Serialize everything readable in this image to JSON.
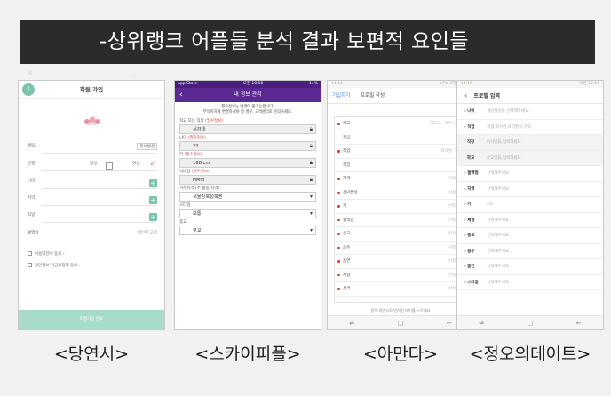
{
  "banner": {
    "title": "-상위랭크 어플들 분석 결과 보편적 요인들"
  },
  "captions": [
    "<당연시>",
    "<스카이피플>",
    "<아만다>",
    "<정오의데이트>"
  ],
  "phone1": {
    "title": "회원 가입",
    "rows": [
      {
        "label": "세팅1",
        "value": "정보변경"
      },
      {
        "label": "성별",
        "value": "남성",
        "extra": "여성"
      },
      {
        "label": "나이",
        "value": "+"
      },
      {
        "label": "지역",
        "value": "+"
      },
      {
        "label": "직업",
        "value": "+"
      },
      {
        "label": "혈액형",
        "value": "확인된 고정"
      }
    ],
    "checks": [
      "이용약관에 동의",
      "개인정보 취급방침에 동의"
    ],
    "footer": "회원가입 완료"
  },
  "phone2": {
    "status_left": "App Store",
    "status_time": "오전 10:10",
    "status_right": "14%",
    "title": "내 정보 관리",
    "note1": "필수정보는 변경이 불가능합니다.",
    "note2": "부득이하게 변경하셔야 할 경우, 고객센터로 문의하세요.",
    "fields": [
      {
        "label": "학교 또는 직장",
        "req": "(필수정보)",
        "value": "서강대",
        "icon": "lock"
      },
      {
        "label": "나이",
        "req": "(필수정보)",
        "value": "22",
        "icon": "lock"
      },
      {
        "label": "키",
        "req": "(필수정보)",
        "value": "168 cm",
        "icon": "lock"
      },
      {
        "label": "닉네임",
        "req": "(필수정보)",
        "value": "HMm",
        "icon": "lock"
      },
      {
        "label": "거주지역 (주 활동 지역)",
        "req": "",
        "value": "서울강북성북권",
        "icon": "dropdown"
      },
      {
        "label": "스타일",
        "req": "",
        "value": "보통",
        "icon": "dropdown"
      },
      {
        "label": "종교",
        "req": "",
        "value": "무교",
        "icon": "dropdown"
      }
    ]
  },
  "phone3": {
    "status_left": "14:16",
    "status_right": "57% 오전 10:16",
    "tabs": [
      "기입하기",
      "프로필 작성"
    ],
    "rows": [
      {
        "label": "학교",
        "value": "대학교 / 학부/ 전공",
        "required": true
      },
      {
        "label": "전공",
        "value": "",
        "required": false
      },
      {
        "label": "직업",
        "value": "회사명, 직종",
        "required": true
      },
      {
        "label": "직장",
        "value": "",
        "required": false
      },
      {
        "label": "지역",
        "value": "선택안함",
        "required": true
      },
      {
        "label": "생년월일",
        "value": "선택안함",
        "required": true
      },
      {
        "label": "키",
        "value": "선택안함",
        "required": true
      },
      {
        "label": "혈액형",
        "value": "선택안함",
        "required": true
      },
      {
        "label": "종교",
        "value": "선택안함",
        "required": true
      },
      {
        "label": "음주",
        "value": "선택안함",
        "required": true
      },
      {
        "label": "흡연",
        "value": "선택안함",
        "required": true
      },
      {
        "label": "체형",
        "value": "선택안함",
        "required": true
      },
      {
        "label": "성격",
        "value": "선택안함",
        "required": true
      }
    ],
    "note": "항목 화면으로 반려된 대기를 누르세요",
    "nav": [
      "⇌",
      "▢",
      "←"
    ]
  },
  "phone4": {
    "status_left": "14:16",
    "status_right": "오전 10:16",
    "title": "프로필 입력",
    "rows": [
      {
        "label": "나이",
        "value": "생년월일을 선택해주세요.",
        "gray": false
      },
      {
        "label": "직업",
        "value": "학생,회사원,프리랜서,무직",
        "gray": false
      },
      {
        "label": "직장",
        "value": "회사명을 입력하세요.",
        "gray": true
      },
      {
        "label": "학교",
        "value": "학교명을 입력하세요.",
        "gray": true
      },
      {
        "label": "혈액형",
        "value": "선택해주세요.",
        "gray": false
      },
      {
        "label": "지역",
        "value": "선택해주세요.",
        "gray": false
      },
      {
        "label": "키",
        "value": "cm",
        "gray": false
      },
      {
        "label": "체형",
        "value": "선택해주세요.",
        "gray": false
      },
      {
        "label": "종교",
        "value": "선택해주세요.",
        "gray": false
      },
      {
        "label": "음주",
        "value": "선택해주세요.",
        "gray": false
      },
      {
        "label": "흡연",
        "value": "선택해주세요.",
        "gray": false
      },
      {
        "label": "스타일",
        "value": "선택해주세요.",
        "gray": false
      }
    ],
    "nav": [
      "⇌",
      "▢",
      "←"
    ]
  }
}
